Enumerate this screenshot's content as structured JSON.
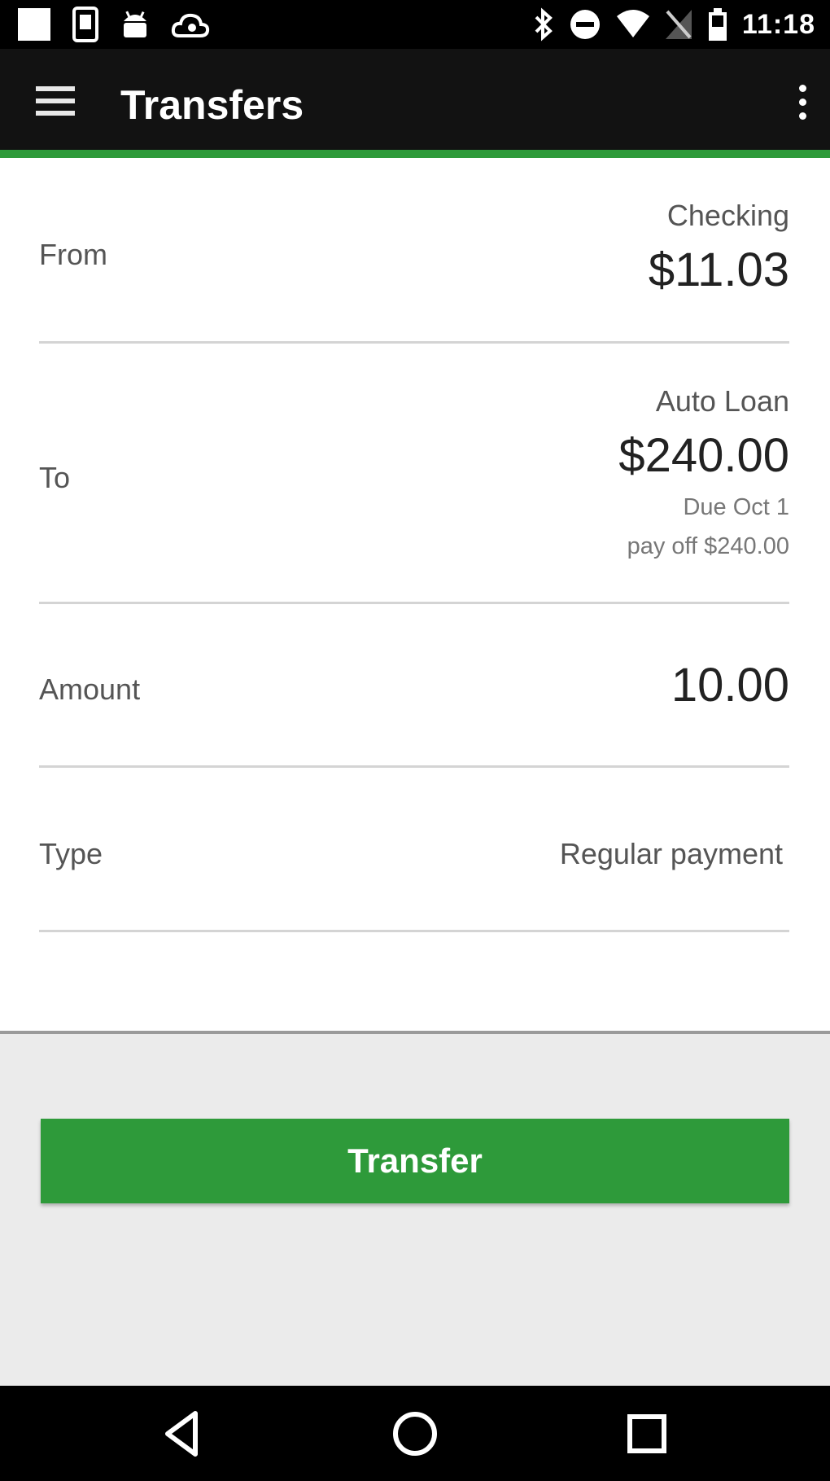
{
  "status_bar": {
    "time": "11:18",
    "left_icons": [
      "notification-square-icon",
      "sim-card-icon",
      "android-icon",
      "cloud-icon"
    ],
    "right_icons": [
      "bluetooth-icon",
      "do-not-disturb-icon",
      "wifi-icon",
      "no-signal-icon",
      "battery-icon"
    ]
  },
  "app_bar": {
    "title": "Transfers",
    "menu_icon": "hamburger-menu-icon",
    "overflow_icon": "more-vert-icon"
  },
  "form": {
    "from": {
      "label": "From",
      "account": "Checking",
      "amount": "$11.03"
    },
    "to": {
      "label": "To",
      "account": "Auto Loan",
      "amount": "$240.00",
      "due": "Due Oct 1",
      "payoff": "pay off $240.00"
    },
    "amount": {
      "label": "Amount",
      "value": "10.00"
    },
    "type": {
      "label": "Type",
      "value": "Regular payment"
    }
  },
  "actions": {
    "transfer_label": "Transfer"
  },
  "nav_bar": {
    "icons": [
      "back-icon",
      "home-icon",
      "recents-icon"
    ]
  },
  "colors": {
    "accent": "#2e9a3a",
    "app_bar": "#121212",
    "lower_background": "#ebebeb"
  }
}
